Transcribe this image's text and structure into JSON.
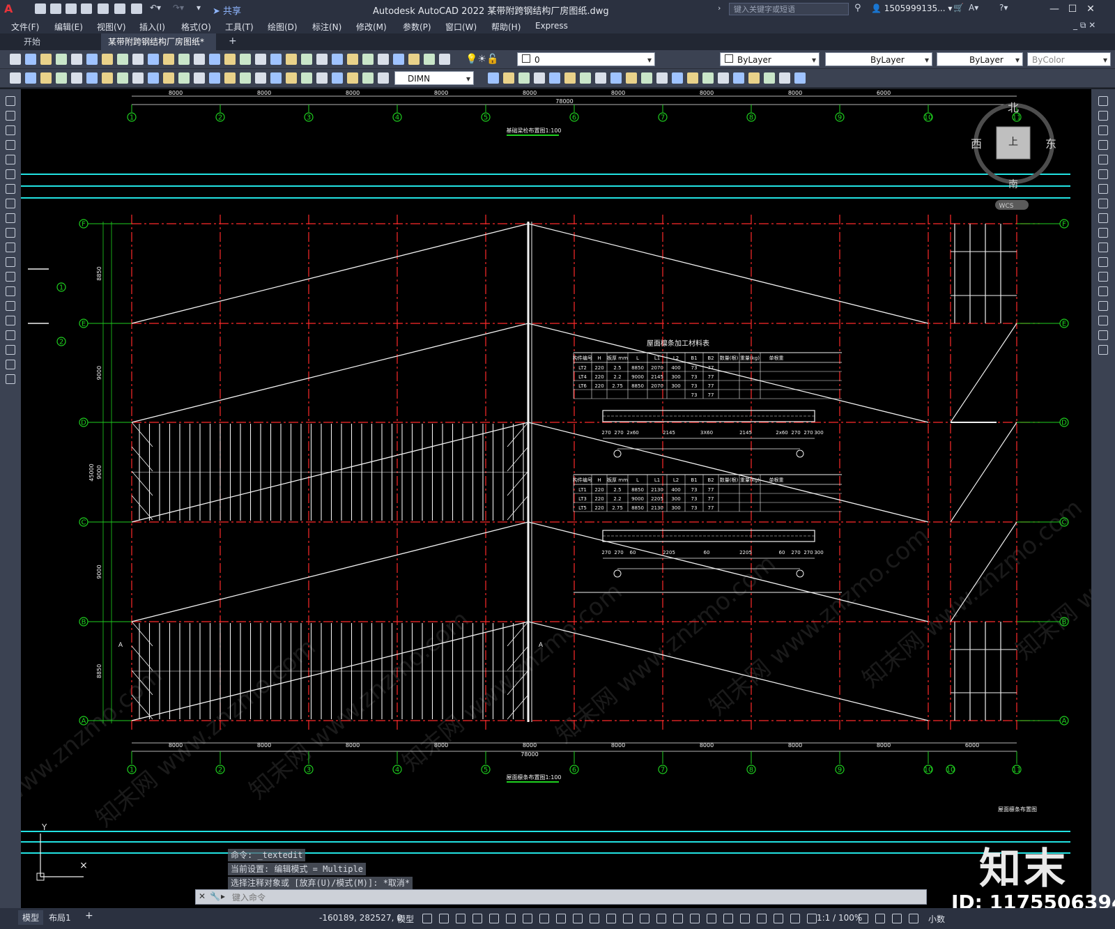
{
  "app": {
    "logo": "A",
    "title": "Autodesk AutoCAD 2022    某带附跨钢结构厂房图纸.dwg",
    "share_label": "共享",
    "search_placeholder": "键入关键字或短语",
    "user": "1505999135..."
  },
  "menu": [
    "文件(F)",
    "编辑(E)",
    "视图(V)",
    "插入(I)",
    "格式(O)",
    "工具(T)",
    "绘图(D)",
    "标注(N)",
    "修改(M)",
    "参数(P)",
    "窗口(W)",
    "帮助(H)",
    "Express"
  ],
  "tabs": {
    "start": "开始",
    "file": "某带附跨钢结构厂房图纸*"
  },
  "toolbar": {
    "layer": "0",
    "color": "ByLayer",
    "linetype": "ByLayer",
    "lineweight": "ByLayer",
    "plotstyle": "ByColor",
    "dimstyle": "DIMN"
  },
  "drawing": {
    "col_labels": [
      "1",
      "2",
      "3",
      "4",
      "5",
      "6",
      "7",
      "8",
      "9",
      "10",
      "11"
    ],
    "right_col_labels": [
      "10",
      "11"
    ],
    "row_labels": [
      "F",
      "E",
      "D",
      "C",
      "B",
      "A"
    ],
    "top_dims": [
      "8000",
      "8000",
      "8000",
      "8000",
      "8000",
      "8000",
      "8000",
      "8000",
      "6000"
    ],
    "top_total": "78000",
    "bottom_dims": [
      "8000",
      "8000",
      "8000",
      "8000",
      "8000",
      "8000",
      "8000",
      "8000",
      "8000",
      "6000"
    ],
    "bottom_total": "78000",
    "left_dims": [
      "8850",
      "9000",
      "9000",
      "9000",
      "8850"
    ],
    "left_total": "45000",
    "top_plan_title": "基础梁检布置图1:100",
    "bottom_plan_title": "屋面檩条布置图1:100",
    "right_plan_title": "屋面檩条布置图",
    "compass": {
      "north": "北",
      "south": "南",
      "east": "东",
      "west": "西",
      "top_label": "上",
      "wcs": "WCS"
    },
    "detail_marks": [
      "1",
      "2"
    ],
    "table_title": "屋面檩条加工材料表",
    "table_headers": [
      "构件编号",
      "H",
      "板厚 mm",
      "L",
      "L1",
      "L2",
      "B1",
      "B2",
      "数量(根)",
      "重量(kg)",
      "单根重"
    ],
    "table1_rows": [
      [
        "LT2",
        "220",
        "2.5",
        "8850",
        "2070",
        "400",
        "73",
        "77",
        "",
        "",
        ""
      ],
      [
        "LT4",
        "220",
        "2.2",
        "9000",
        "2145",
        "300",
        "73",
        "77",
        "",
        "",
        ""
      ],
      [
        "LT6",
        "220",
        "2.75",
        "8850",
        "2070",
        "300",
        "73",
        "77",
        "",
        "",
        ""
      ],
      [
        "",
        "",
        "",
        "",
        "",
        "",
        "73",
        "77",
        "",
        "",
        ""
      ]
    ],
    "table2_rows": [
      [
        "LT1",
        "220",
        "2.5",
        "8850",
        "2130",
        "400",
        "73",
        "77",
        "",
        "",
        ""
      ],
      [
        "LT3",
        "220",
        "2.2",
        "9000",
        "2205",
        "300",
        "73",
        "77",
        "",
        "",
        ""
      ],
      [
        "LT5",
        "220",
        "2.75",
        "8850",
        "2130",
        "300",
        "73",
        "77",
        "",
        "",
        ""
      ]
    ],
    "detail1_dims": [
      "270",
      "270",
      "2x60",
      "2145",
      "3X60",
      "2145",
      "2x60",
      "270",
      "270",
      "300"
    ],
    "detail2_dims": [
      "270",
      "270",
      "60",
      "2205",
      "60",
      "2205",
      "60",
      "270",
      "270",
      "300"
    ],
    "section_mark": "A"
  },
  "command": {
    "history": [
      "命令: _textedit",
      "当前设置: 编辑模式 = Multiple",
      "选择注释对象或 [放弃(U)/模式(M)]: *取消*"
    ],
    "placeholder": "键入命令"
  },
  "status": {
    "model_tab": "模型",
    "layout_tab": "布局1",
    "coords": "-160189, 282527, 0",
    "space": "模型",
    "scale": "1:1 / 100%",
    "units": "小数"
  },
  "watermark": {
    "brand": "知末",
    "id": "ID: 1175506394"
  },
  "colors": {
    "grid_red": "#ff2a2a",
    "grid_green": "#1fd11f",
    "cyan": "#22e3e3",
    "white": "#f2f2f2"
  }
}
